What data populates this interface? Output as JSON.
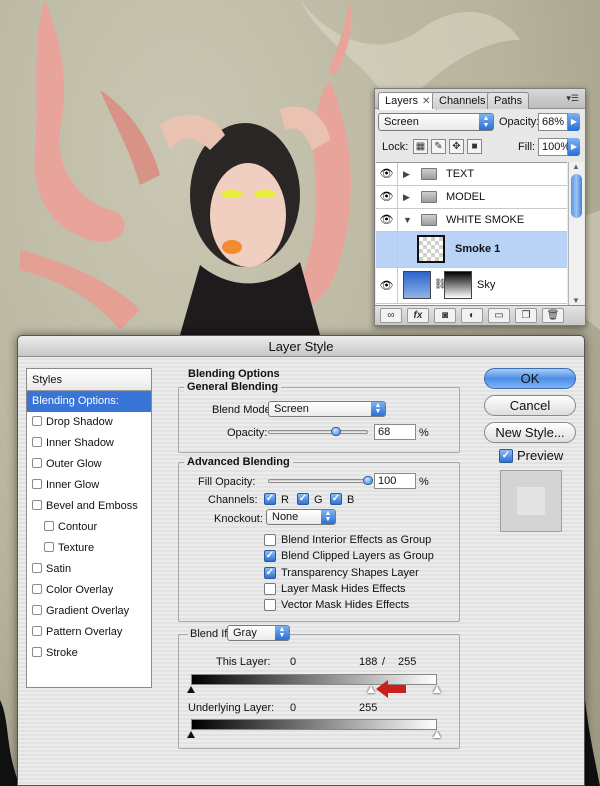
{
  "layers_panel": {
    "tabs": [
      "Layers",
      "Channels",
      "Paths"
    ],
    "close_glyph": "✕",
    "blend_mode": "Screen",
    "opacity_label": "Opacity:",
    "opacity_value": "68%",
    "lock_label": "Lock:",
    "fill_label": "Fill:",
    "fill_value": "100%",
    "layers": [
      {
        "name": "TEXT",
        "type": "group",
        "expanded": false
      },
      {
        "name": "MODEL",
        "type": "group",
        "expanded": false
      },
      {
        "name": "WHITE SMOKE",
        "type": "group",
        "expanded": true
      },
      {
        "name": "Smoke 1",
        "type": "layer",
        "selected": true
      },
      {
        "name": "Sky",
        "type": "layer",
        "selected": false
      }
    ],
    "footer_icons": [
      "link-icon",
      "fx-icon",
      "mask-icon",
      "adjustment-icon",
      "folder-icon",
      "new-layer-icon",
      "trash-icon"
    ]
  },
  "dialog": {
    "title": "Layer Style",
    "styles_header": "Styles",
    "styles": [
      {
        "label": "Blending Options: Custom",
        "active": true,
        "checkbox": false,
        "indent": false
      },
      {
        "label": "Drop Shadow",
        "checkbox": true,
        "indent": false
      },
      {
        "label": "Inner Shadow",
        "checkbox": true,
        "indent": false
      },
      {
        "label": "Outer Glow",
        "checkbox": true,
        "indent": false
      },
      {
        "label": "Inner Glow",
        "checkbox": true,
        "indent": false
      },
      {
        "label": "Bevel and Emboss",
        "checkbox": true,
        "indent": false
      },
      {
        "label": "Contour",
        "checkbox": true,
        "indent": true
      },
      {
        "label": "Texture",
        "checkbox": true,
        "indent": true
      },
      {
        "label": "Satin",
        "checkbox": true,
        "indent": false
      },
      {
        "label": "Color Overlay",
        "checkbox": true,
        "indent": false
      },
      {
        "label": "Gradient Overlay",
        "checkbox": true,
        "indent": false
      },
      {
        "label": "Pattern Overlay",
        "checkbox": true,
        "indent": false
      },
      {
        "label": "Stroke",
        "checkbox": true,
        "indent": false
      }
    ],
    "blending_options": "Blending Options",
    "general_blending": "General Blending",
    "blend_mode_label": "Blend Mode:",
    "blend_mode_value": "Screen",
    "opacity_label": "Opacity:",
    "opacity_value": "68",
    "percent": "%",
    "advanced_blending": "Advanced Blending",
    "fill_opacity_label": "Fill Opacity:",
    "fill_opacity_value": "100",
    "channels_label": "Channels:",
    "channels": [
      "R",
      "G",
      "B"
    ],
    "knockout_label": "Knockout:",
    "knockout_value": "None",
    "checkboxes": [
      {
        "label": "Blend Interior Effects as Group",
        "checked": false
      },
      {
        "label": "Blend Clipped Layers as Group",
        "checked": true
      },
      {
        "label": "Transparency Shapes Layer",
        "checked": true
      },
      {
        "label": "Layer Mask Hides Effects",
        "checked": false
      },
      {
        "label": "Vector Mask Hides Effects",
        "checked": false
      }
    ],
    "blend_if_label": "Blend If:",
    "blend_if_value": "Gray",
    "this_layer_label": "This Layer:",
    "this_layer_min": "0",
    "this_layer_max_split": "188",
    "slash": "/",
    "this_layer_max": "255",
    "underlying_label": "Underlying Layer:",
    "underlying_min": "0",
    "underlying_max": "255",
    "buttons": {
      "ok": "OK",
      "cancel": "Cancel",
      "new_style": "New Style..."
    },
    "preview_label": "Preview",
    "preview_checked": true,
    "opacity_slider_fraction": 0.68,
    "fill_slider_fraction": 1.0
  },
  "colors": {
    "accent": "#3875d7",
    "arrow": "#cc1e1e",
    "paint": "#e8a49a"
  }
}
